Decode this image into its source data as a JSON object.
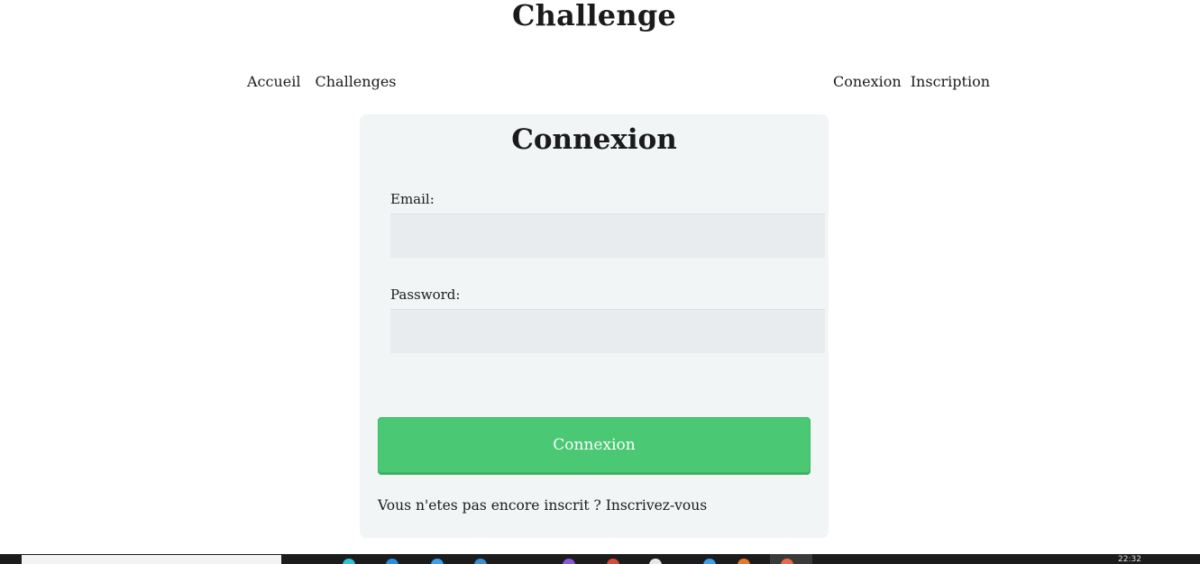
{
  "site": {
    "title": "Challenge"
  },
  "nav": {
    "left": [
      "Accueil",
      "Challenges"
    ],
    "right": [
      "Conexion",
      "Inscription"
    ]
  },
  "login": {
    "title": "Connexion",
    "email_label": "Email:",
    "email_value": "",
    "password_label": "Password:",
    "password_value": "",
    "submit_label": "Connexion",
    "signup_prompt": "Vous n'etes pas encore inscrit ?",
    "signup_link": "Inscrivez-vous"
  },
  "taskbar": {
    "clock": "22:32",
    "icons": [
      "edge-icon",
      "store-icon",
      "explorer-icon",
      "vscode-icon",
      "firefox-icon",
      "chrome-icon",
      "mail-icon",
      "folder-icon",
      "app-icon",
      "app-active-icon"
    ],
    "colors": [
      "#2ec4d8",
      "#2a8de0",
      "#3aa0e8",
      "#3b8fd0",
      "#8a58d8",
      "#d84a3a",
      "#e8e8e8",
      "#3aa0e8",
      "#e8782a",
      "#e86a4a"
    ]
  },
  "colors": {
    "primary_button": "#4ac873",
    "card_background": "#f2f5f6",
    "input_background": "#e8ecee"
  }
}
